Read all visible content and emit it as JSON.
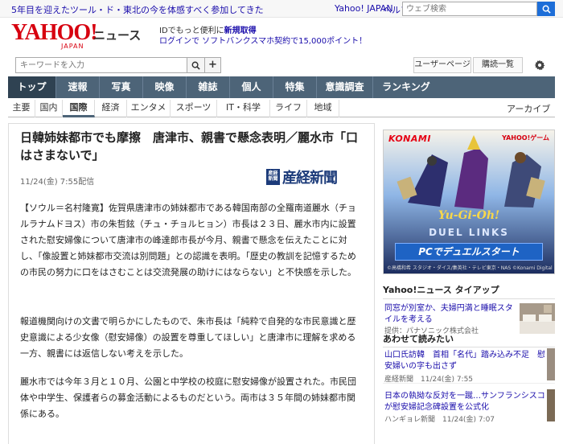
{
  "topbar": {
    "promo": "5年目を迎えたツール・ド・東北の今を体感すべく参加してきた",
    "yahoo_japan": "Yahoo! JAPAN",
    "help": "ヘルプ",
    "web_search_placeholder": "ウェブ検索"
  },
  "header": {
    "logo": "YAHOO!",
    "logo_sub": "JAPAN",
    "section": "ニュース",
    "notice_prefix": "IDでもっと便利に",
    "notice_highlight": "新規取得",
    "notice2": "ログインで ソフトバンクスマホ契約で15,000ポイント！"
  },
  "search": {
    "keyword_placeholder": "キーワードを入力",
    "plus": "+",
    "user_page": "ユーザーページ",
    "subscribe": "購読一覧"
  },
  "main_nav": [
    {
      "label": "トップ",
      "active": true
    },
    {
      "label": "速報",
      "active": false
    },
    {
      "label": "写真",
      "active": false
    },
    {
      "label": "映像",
      "active": false
    },
    {
      "label": "雑誌",
      "active": false
    },
    {
      "label": "個人",
      "active": false
    },
    {
      "label": "特集",
      "active": false
    },
    {
      "label": "意識調査",
      "active": false
    },
    {
      "label": "ランキング",
      "active": false
    }
  ],
  "sub_nav": [
    {
      "label": "主要",
      "active": false
    },
    {
      "label": "国内",
      "active": false
    },
    {
      "label": "国際",
      "active": true
    },
    {
      "label": "経済",
      "active": false
    },
    {
      "label": "エンタメ",
      "active": false
    },
    {
      "label": "スポーツ",
      "active": false
    },
    {
      "label": "IT・科学",
      "active": false
    },
    {
      "label": "ライフ",
      "active": false
    },
    {
      "label": "地域",
      "active": false
    }
  ],
  "archive": "アーカイブ",
  "article": {
    "headline": "日韓姉妹都市でも摩擦　唐津市、親書で懸念表明／麗水市「口はさまないで」",
    "date": "11/24(金) 7:55配信",
    "source_badge": "産経新聞",
    "source": "産経新聞",
    "paragraphs": [
      "【ソウル＝名村隆寛】佐賀県唐津市の姉妹都市である韓国南部の全羅南道麗水（チョルラナムドヨス）市の朱哲鉉（チュ・チョルヒョン）市長は２３日、麗水市内に設置された慰安婦像について唐津市の峰達郎市長が今月、親書で懸念を伝えたことに対し、「像設置と姉妹都市交流は別問題」との認識を表明。「歴史の教訓を記憶するための市民の努力に口をはさむことは交流発展の助けにはならない」と不快感を示した。",
      "報道機関向けの文書で明らかにしたもので、朱市長は「純粋で自発的な市民意識と歴史意識による少女像（慰安婦像）の設置を尊重してほしい」と唐津市に理解を求める一方、親書には返信しない考えを示した。",
      "麗水市では今年３月と１０月、公園と中学校の校庭に慰安婦像が設置された。市民団体や中学生、保護者らの募金活動によるものだという。両市は３５年間の姉妹都市関係にある。"
    ]
  },
  "ad": {
    "brand": "KONAMI",
    "partner": "YAHOO!ゲーム",
    "title": "Yu-Gi-Oh!",
    "subtitle": "DUEL LINKS",
    "cta": "PCでデュエルスタート",
    "credit": "©高橋和希 スタジオ・ダイス/集英社・テレビ東京・NAS ©Konami Digital Entertainment"
  },
  "tieup": {
    "heading": "Yahoo!ニュース タイアップ",
    "text": "同窓が別室か、夫婦円満と睡眠スタイルを考える",
    "provider": "提供：パナソニック株式会社"
  },
  "recommend": {
    "heading": "あわせて読みたい",
    "items": [
      {
        "text": "山口氏訪韓　首相「名代」踏み込み不足　慰安婦いの字も出さず",
        "meta": "産経新聞　11/24(金) 7:55"
      },
      {
        "text": "日本の執拗な反対を一蹴…サンフランシスコが慰安婦記念碑設置を公式化",
        "meta": "ハンギョレ新聞　11/24(金) 7:07"
      }
    ]
  },
  "colors": {
    "nav_bg": "#4d6478",
    "nav_active": "#2f4252",
    "logo_red": "#d7000f",
    "link_blue": "#1a0dab"
  }
}
